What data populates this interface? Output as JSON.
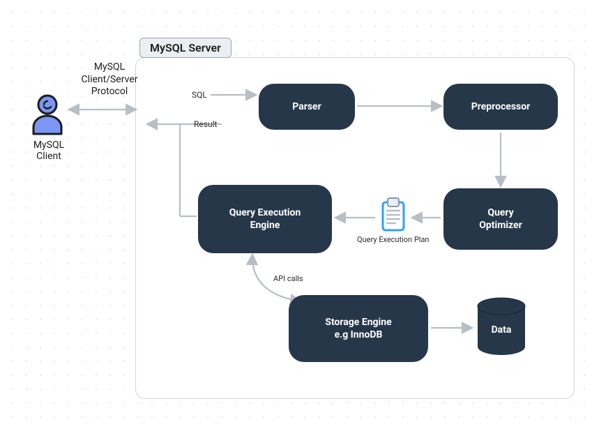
{
  "diagram": {
    "server_label": "MySQL Server",
    "client_label": "MySQL\nClient",
    "protocol_label": "MySQL\nClient/Server\nProtocol",
    "nodes": {
      "parser": "Parser",
      "preprocessor": "Preprocessor",
      "query_optimizer_l1": "Query",
      "query_optimizer_l2": "Optimizer",
      "qee_l1": "Query Execution",
      "qee_l2": "Engine",
      "storage_l1": "Storage Engine",
      "storage_l2": "e.g InnoDB",
      "data": "Data"
    },
    "edges": {
      "sql": "SQL",
      "result": "Result",
      "qep": "Query Execution Plan",
      "api_calls": "API calls"
    },
    "colors": {
      "node_bg": "#27374a",
      "arrow": "#b8bec5",
      "accent": "#29a3ff",
      "client_body": "#7b96f4",
      "client_stroke": "#1c1c1c"
    }
  }
}
